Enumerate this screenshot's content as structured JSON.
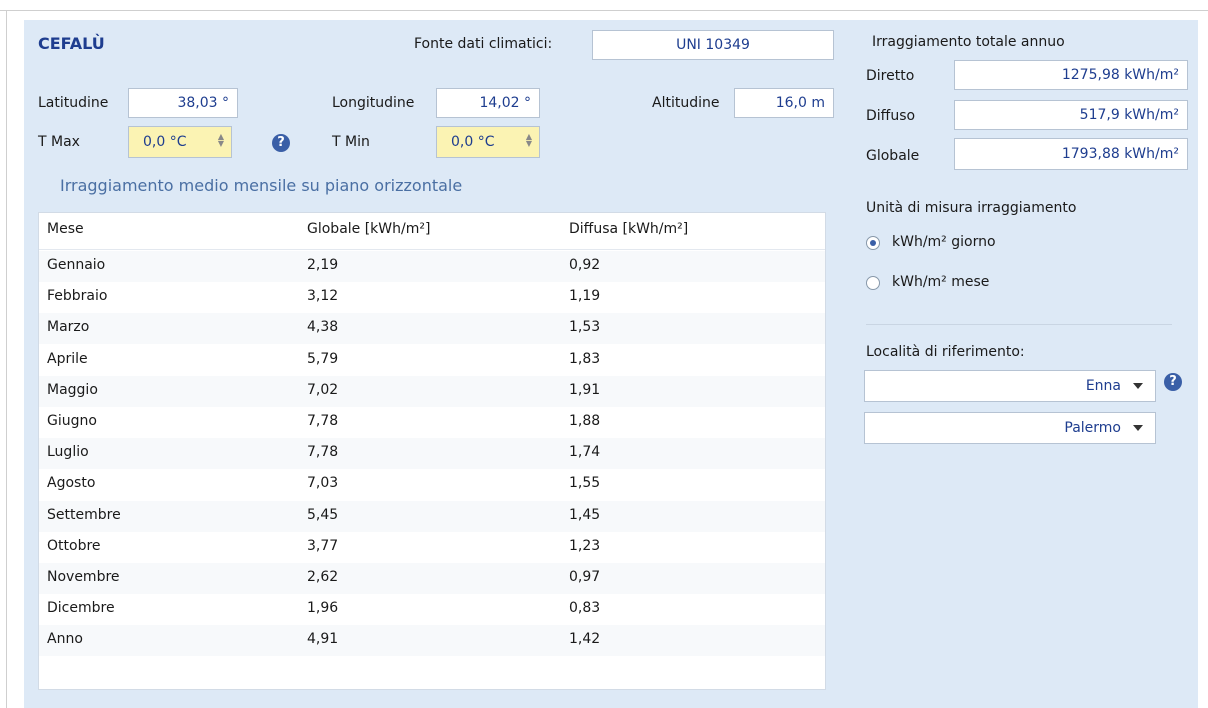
{
  "header": {
    "city": "CEFALÙ",
    "source_label": "Fonte dati climatici:",
    "source_value": "UNI 10349"
  },
  "params": {
    "lat_label": "Latitudine",
    "lat_value": "38,03 °",
    "lon_label": "Longitudine",
    "lon_value": "14,02 °",
    "alt_label": "Altitudine",
    "alt_value": "16,0 m",
    "tmax_label": "T Max",
    "tmax_value": "0,0 °C",
    "tmin_label": "T Min",
    "tmin_value": "0,0 °C",
    "help_glyph": "?"
  },
  "table": {
    "section_title": "Irraggiamento medio mensile su piano orizzontale",
    "headers": [
      "Mese",
      "Globale [kWh/m²]",
      "Diffusa [kWh/m²]"
    ],
    "rows": [
      [
        "Gennaio",
        "2,19",
        "0,92"
      ],
      [
        "Febbraio",
        "3,12",
        "1,19"
      ],
      [
        "Marzo",
        "4,38",
        "1,53"
      ],
      [
        "Aprile",
        "5,79",
        "1,83"
      ],
      [
        "Maggio",
        "7,02",
        "1,91"
      ],
      [
        "Giugno",
        "7,78",
        "1,88"
      ],
      [
        "Luglio",
        "7,78",
        "1,74"
      ],
      [
        "Agosto",
        "7,03",
        "1,55"
      ],
      [
        "Settembre",
        "5,45",
        "1,45"
      ],
      [
        "Ottobre",
        "3,77",
        "1,23"
      ],
      [
        "Novembre",
        "2,62",
        "0,97"
      ],
      [
        "Dicembre",
        "1,96",
        "0,83"
      ],
      [
        "Anno",
        "4,91",
        "1,42"
      ]
    ]
  },
  "annual": {
    "title": "Irraggiamento totale annuo",
    "diretto_label": "Diretto",
    "diretto_value": "1275,98 kWh/m²",
    "diffuso_label": "Diffuso",
    "diffuso_value": "517,9 kWh/m²",
    "globale_label": "Globale",
    "globale_value": "1793,88 kWh/m²"
  },
  "units": {
    "title": "Unità di misura irraggiamento",
    "options": [
      "kWh/m² giorno",
      "kWh/m² mese"
    ],
    "selected": "kWh/m² giorno"
  },
  "reference": {
    "title": "Località di riferimento:",
    "location1": "Enna",
    "location2": "Palermo"
  },
  "icons": {
    "help": "help-icon",
    "dropdown": "chevron-down-icon",
    "spinner": "spinner-arrows-icon"
  },
  "colors": {
    "panel": "#dde9f6",
    "accent": "#1e3d8f",
    "highlight": "#fbf3b3"
  }
}
